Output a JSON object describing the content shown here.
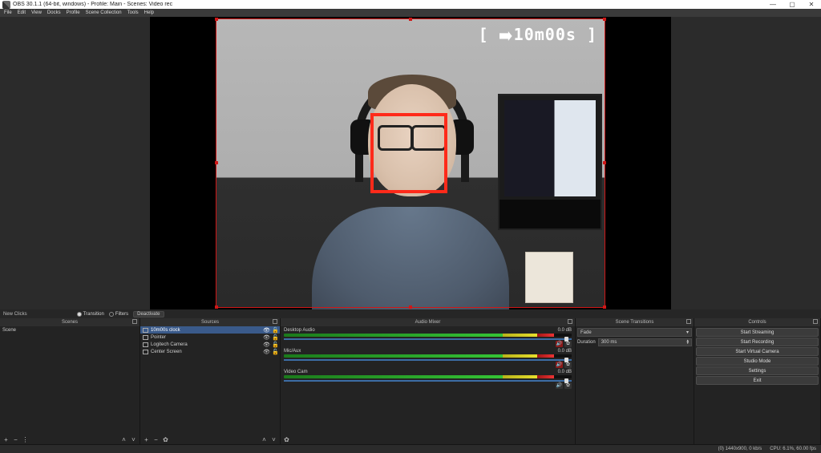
{
  "window": {
    "title": "OBS 30.1.1 (64-bit, windows) - Profile: Main - Scenes: Video rec",
    "min": "—",
    "max": "▢",
    "close": "✕"
  },
  "menu": [
    "File",
    "Edit",
    "View",
    "Docks",
    "Profile",
    "Scene Collection",
    "Tools",
    "Help"
  ],
  "overlay": {
    "timestamp": "10m00s"
  },
  "midbar": {
    "label": "New Clicks",
    "transition_label": "Transition",
    "filters_label": "Filters",
    "deactivate_label": "Deactivate"
  },
  "panels": {
    "scenes": {
      "title": "Scenes",
      "items": [
        "Scene"
      ]
    },
    "sources": {
      "title": "Sources",
      "items": [
        {
          "name": "10m00s clock",
          "selected": true
        },
        {
          "name": "Pointer"
        },
        {
          "name": "Logitech Camera"
        },
        {
          "name": "Center Screen"
        }
      ]
    },
    "mixer": {
      "title": "Audio Mixer",
      "tracks": [
        {
          "name": "Desktop Audio",
          "db": "0.0 dB",
          "g": 76,
          "y": 12,
          "r": 6,
          "muted": true
        },
        {
          "name": "Mic/Aux",
          "db": "0.0 dB",
          "g": 76,
          "y": 12,
          "r": 6,
          "muted": true
        },
        {
          "name": "Video Cam",
          "db": "0.0 dB",
          "g": 76,
          "y": 12,
          "r": 6,
          "muted": false
        }
      ]
    },
    "transitions": {
      "title": "Scene Transitions",
      "current": "Fade",
      "duration_label": "Duration",
      "duration_value": "300 ms"
    },
    "controls": {
      "title": "Controls",
      "buttons": [
        "Start Streaming",
        "Start Recording",
        "Start Virtual Camera",
        "Studio Mode",
        "Settings",
        "Exit"
      ]
    }
  },
  "status": {
    "cpu": "CPU: 6.1%, 60.00 fps",
    "res": "(0) 1440x900, 0 kb/s"
  }
}
